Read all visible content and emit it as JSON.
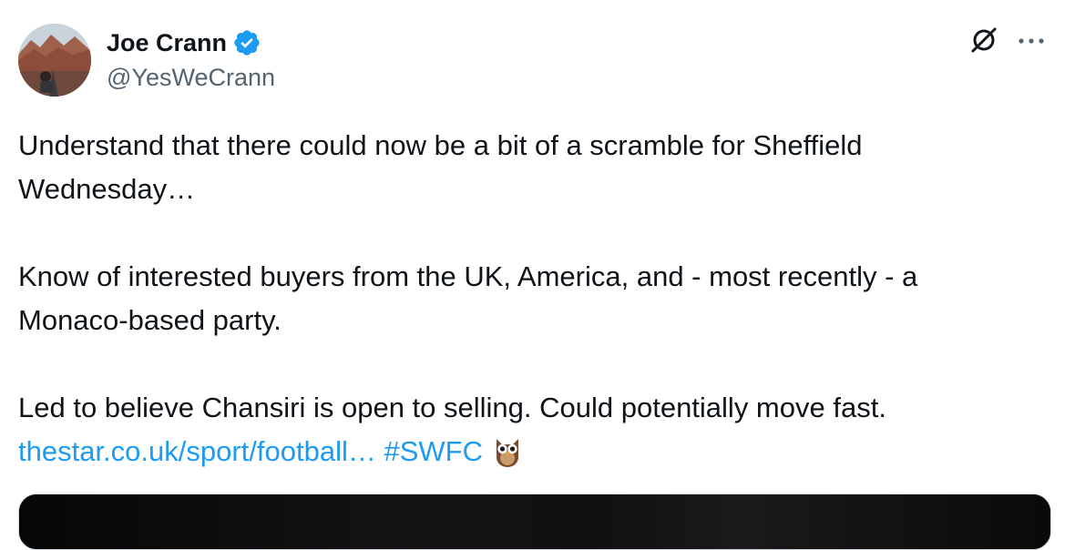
{
  "author": {
    "display_name": "Joe Crann",
    "handle": "@YesWeCrann",
    "verified": true
  },
  "header_actions": {
    "grok_icon": "grok-icon",
    "more_icon": "more-dots-icon"
  },
  "tweet": {
    "paragraphs": [
      [
        "Understand that there could now be a bit of a scramble for Sheffield",
        "Wednesday…"
      ],
      [
        "Know of interested buyers from the UK, America, and - most recently - a",
        "Monaco-based party."
      ],
      [
        "Led to believe Chansiri is open to selling. Could potentially move fast."
      ]
    ],
    "link_text": "thestar.co.uk/sport/football…",
    "hashtag": "#SWFC",
    "emoji": "owl"
  },
  "colors": {
    "link": "#1d9bf0",
    "text": "#0f1419",
    "secondary": "#536471",
    "verified": "#1d9bf0"
  }
}
